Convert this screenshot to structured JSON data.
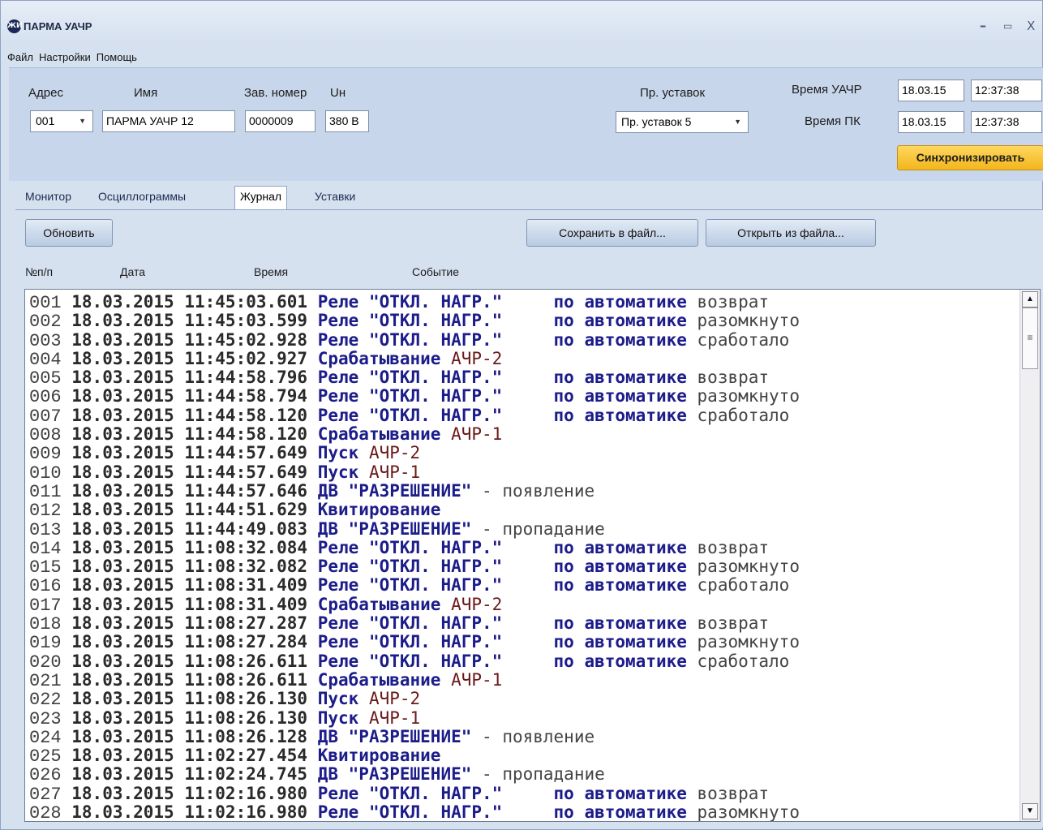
{
  "window": {
    "logo": "ЖИ",
    "title": "ПАРМА УАЧР",
    "minimize": "–",
    "maximize": "▭",
    "close": "X"
  },
  "menu": [
    "Файл",
    "Настройки",
    "Помощь"
  ],
  "device": {
    "address_label": "Адрес",
    "address_value": "001",
    "name_label": "Имя",
    "name_value": "ПАРМА УАЧР 12",
    "serial_label": "Зав. номер",
    "serial_value": "0000009",
    "un_label": "Uн",
    "un_value": "380 В",
    "settings_label": "Пр. уставок",
    "settings_value": "Пр. уставок 5"
  },
  "time": {
    "device_label": "Время УАЧР",
    "device_date": "18.03.15",
    "device_time": "12:37:38",
    "pc_label": "Время ПК",
    "pc_date": "18.03.15",
    "pc_time": "12:37:38",
    "sync_button": "Синхронизировать"
  },
  "tabs": [
    "Монитор",
    "Осциллограммы",
    "Журнал",
    "Уставки"
  ],
  "active_tab": "Журнал",
  "journal": {
    "refresh_button": "Обновить",
    "save_button": "Сохранить в файл...",
    "open_button": "Открыть из файла...",
    "columns": [
      "№п/п",
      "Дата",
      "Время",
      "Событие"
    ],
    "rows": [
      {
        "n": "001",
        "date": "18.03.2015",
        "time": "11:45:03.601",
        "ev": "Реле \"ОТКЛ. НАГР.\"     по автоматике",
        "tail": " возврат"
      },
      {
        "n": "002",
        "date": "18.03.2015",
        "time": "11:45:03.599",
        "ev": "Реле \"ОТКЛ. НАГР.\"     по автоматике",
        "tail": " разомкнуто"
      },
      {
        "n": "003",
        "date": "18.03.2015",
        "time": "11:45:02.928",
        "ev": "Реле \"ОТКЛ. НАГР.\"     по автоматике",
        "tail": " сработало"
      },
      {
        "n": "004",
        "date": "18.03.2015",
        "time": "11:45:02.927",
        "ev": "Срабатывание",
        "evs": " АЧР-2",
        "tail": ""
      },
      {
        "n": "005",
        "date": "18.03.2015",
        "time": "11:44:58.796",
        "ev": "Реле \"ОТКЛ. НАГР.\"     по автоматике",
        "tail": " возврат"
      },
      {
        "n": "006",
        "date": "18.03.2015",
        "time": "11:44:58.794",
        "ev": "Реле \"ОТКЛ. НАГР.\"     по автоматике",
        "tail": " разомкнуто"
      },
      {
        "n": "007",
        "date": "18.03.2015",
        "time": "11:44:58.120",
        "ev": "Реле \"ОТКЛ. НАГР.\"     по автоматике",
        "tail": " сработало"
      },
      {
        "n": "008",
        "date": "18.03.2015",
        "time": "11:44:58.120",
        "ev": "Срабатывание",
        "evs": " АЧР-1",
        "tail": ""
      },
      {
        "n": "009",
        "date": "18.03.2015",
        "time": "11:44:57.649",
        "ev": "Пуск",
        "evs": " АЧР-2",
        "tail": ""
      },
      {
        "n": "010",
        "date": "18.03.2015",
        "time": "11:44:57.649",
        "ev": "Пуск",
        "evs": " АЧР-1",
        "tail": ""
      },
      {
        "n": "011",
        "date": "18.03.2015",
        "time": "11:44:57.646",
        "ev": "ДВ \"РАЗРЕШЕНИЕ\"",
        "tail": " - появление"
      },
      {
        "n": "012",
        "date": "18.03.2015",
        "time": "11:44:51.629",
        "ev": "Квитирование",
        "tail": ""
      },
      {
        "n": "013",
        "date": "18.03.2015",
        "time": "11:44:49.083",
        "ev": "ДВ \"РАЗРЕШЕНИЕ\"",
        "tail": " - пропадание"
      },
      {
        "n": "014",
        "date": "18.03.2015",
        "time": "11:08:32.084",
        "ev": "Реле \"ОТКЛ. НАГР.\"     по автоматике",
        "tail": " возврат"
      },
      {
        "n": "015",
        "date": "18.03.2015",
        "time": "11:08:32.082",
        "ev": "Реле \"ОТКЛ. НАГР.\"     по автоматике",
        "tail": " разомкнуто"
      },
      {
        "n": "016",
        "date": "18.03.2015",
        "time": "11:08:31.409",
        "ev": "Реле \"ОТКЛ. НАГР.\"     по автоматике",
        "tail": " сработало"
      },
      {
        "n": "017",
        "date": "18.03.2015",
        "time": "11:08:31.409",
        "ev": "Срабатывание",
        "evs": " АЧР-2",
        "tail": ""
      },
      {
        "n": "018",
        "date": "18.03.2015",
        "time": "11:08:27.287",
        "ev": "Реле \"ОТКЛ. НАГР.\"     по автоматике",
        "tail": " возврат"
      },
      {
        "n": "019",
        "date": "18.03.2015",
        "time": "11:08:27.284",
        "ev": "Реле \"ОТКЛ. НАГР.\"     по автоматике",
        "tail": " разомкнуто"
      },
      {
        "n": "020",
        "date": "18.03.2015",
        "time": "11:08:26.611",
        "ev": "Реле \"ОТКЛ. НАГР.\"     по автоматике",
        "tail": " сработало"
      },
      {
        "n": "021",
        "date": "18.03.2015",
        "time": "11:08:26.611",
        "ev": "Срабатывание",
        "evs": " АЧР-1",
        "tail": ""
      },
      {
        "n": "022",
        "date": "18.03.2015",
        "time": "11:08:26.130",
        "ev": "Пуск",
        "evs": " АЧР-2",
        "tail": ""
      },
      {
        "n": "023",
        "date": "18.03.2015",
        "time": "11:08:26.130",
        "ev": "Пуск",
        "evs": " АЧР-1",
        "tail": ""
      },
      {
        "n": "024",
        "date": "18.03.2015",
        "time": "11:08:26.128",
        "ev": "ДВ \"РАЗРЕШЕНИЕ\"",
        "tail": " - появление"
      },
      {
        "n": "025",
        "date": "18.03.2015",
        "time": "11:02:27.454",
        "ev": "Квитирование",
        "tail": ""
      },
      {
        "n": "026",
        "date": "18.03.2015",
        "time": "11:02:24.745",
        "ev": "ДВ \"РАЗРЕШЕНИЕ\"",
        "tail": " - пропадание"
      },
      {
        "n": "027",
        "date": "18.03.2015",
        "time": "11:02:16.980",
        "ev": "Реле \"ОТКЛ. НАГР.\"     по автоматике",
        "tail": " возврат"
      },
      {
        "n": "028",
        "date": "18.03.2015",
        "time": "11:02:16.980",
        "ev": "Реле \"ОТКЛ. НАГР.\"     по автоматике",
        "tail": " разомкнуто"
      }
    ]
  },
  "scrollbar": {
    "up": "▲",
    "down": "▼",
    "grip": "≡"
  }
}
